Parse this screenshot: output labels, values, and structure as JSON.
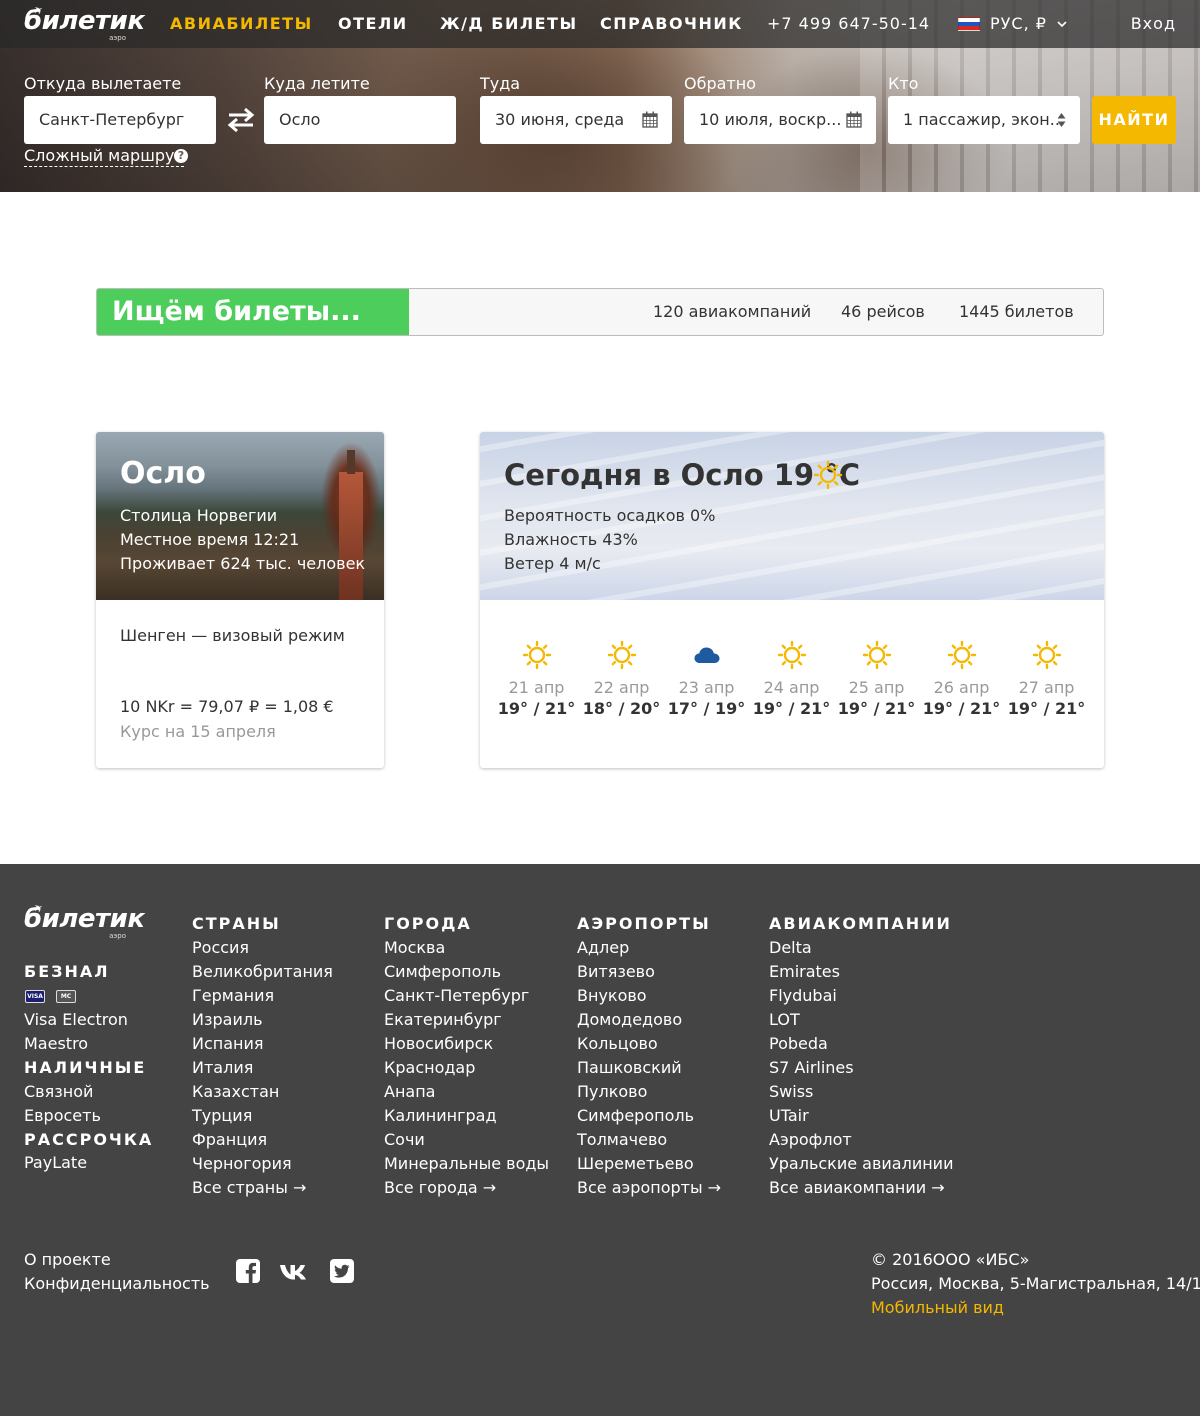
{
  "header": {
    "logo": "билетик",
    "logo_sub": "аэро",
    "nav": [
      "АВИАБИЛЕТЫ",
      "ОТЕЛИ",
      "Ж/Д БИЛЕТЫ",
      "СПРАВОЧНИК"
    ],
    "phone": "+7 499 647-50-14",
    "lang": "РУС, ₽",
    "login": "Вход"
  },
  "search": {
    "from_label": "Откуда вылетаете",
    "from_value": "Санкт-Петербург",
    "to_label": "Куда летите",
    "to_value": "Осло",
    "depart_label": "Туда",
    "depart_value": "30 июня, среда",
    "return_label": "Обратно",
    "return_value": "10 июля, воскр...",
    "who_label": "Кто",
    "who_value": "1 пассажир, экон...",
    "find_button": "НАЙТИ",
    "complex_route": "Сложный маршрут",
    "help_icon": "question-circle-icon"
  },
  "progress": {
    "title": "Ищём билеты...",
    "fraction": 0.31,
    "airlines": "120 авиакомпаний",
    "flights": "46 рейсов",
    "tickets": "1445 билетов"
  },
  "city": {
    "name": "Осло",
    "capital": "Столица Норвегии",
    "local_time": "Местное время 12:21",
    "population": "Проживает 624 тыс. человек",
    "visa": "Шенген — визовый режим",
    "rate": "10 NKr = 79,07 ₽ = 1,08 €",
    "rate_date": "Курс на 15 апреля"
  },
  "weather": {
    "title": "Сегодня в Осло 19 °С",
    "precipitation": "Вероятность осадков 0%",
    "humidity": "Влажность 43%",
    "wind": "Ветер 4 м/с",
    "days": [
      {
        "date": "21 апр",
        "temp": "19° / 21°",
        "icon": "sun-icon"
      },
      {
        "date": "22 апр",
        "temp": "18° / 20°",
        "icon": "sun-icon"
      },
      {
        "date": "23 апр",
        "temp": "17° / 19°",
        "icon": "cloud-icon"
      },
      {
        "date": "24 апр",
        "temp": "19° / 21°",
        "icon": "sun-icon"
      },
      {
        "date": "25 апр",
        "temp": "19° / 21°",
        "icon": "sun-icon"
      },
      {
        "date": "26 апр",
        "temp": "19° / 21°",
        "icon": "sun-icon"
      },
      {
        "date": "27 апр",
        "temp": "19° / 21°",
        "icon": "sun-icon"
      }
    ]
  },
  "footer": {
    "logo": "билетик",
    "logo_sub": "аэро",
    "payment": {
      "cashless_title": "БЕЗНАЛ",
      "cards": [
        "visa-icon",
        "mastercard-icon"
      ],
      "card_labels": [
        "VISA",
        "MC"
      ],
      "cashless_items": [
        "Visa Electron",
        "Maestro"
      ],
      "cash_title": "НАЛИЧНЫЕ",
      "cash_items": [
        "Связной",
        "Евросеть"
      ],
      "installment_title": "РАССРОЧКА",
      "installment_items": [
        "PayLate"
      ]
    },
    "columns": [
      {
        "title": "СТРАНЫ",
        "items": [
          "Россия",
          "Великобритания",
          "Германия",
          "Израиль",
          "Испания",
          "Италия",
          "Казахстан",
          "Турция",
          "Франция",
          "Черногория",
          "Все страны →"
        ]
      },
      {
        "title": "ГОРОДА",
        "items": [
          "Москва",
          "Симферополь",
          "Санкт-Петербург",
          "Екатеринбург",
          "Новосибирск",
          "Краснодар",
          "Анапа",
          "Калининград",
          "Сочи",
          "Минеральные воды",
          "Все города →"
        ]
      },
      {
        "title": "АЭРОПОРТЫ",
        "items": [
          "Адлер",
          "Витязево",
          "Внуково",
          "Домодедово",
          "Кольцово",
          "Пашковский",
          "Пулково",
          "Симферополь",
          "Толмачево",
          "Шереметьево",
          "Все аэропорты →"
        ]
      },
      {
        "title": "АВИАКОМПАНИИ",
        "items": [
          "Delta",
          "Emirates",
          "Flydubai",
          "LOT",
          "Pobeda",
          "S7 Airlines",
          "Swiss",
          "UTair",
          "Аэрофлот",
          "Уральские авиалинии",
          "Все авиакомпании →"
        ]
      }
    ],
    "about": "О проекте",
    "privacy": "Конфиденциальность",
    "social": [
      "facebook-icon",
      "vk-icon",
      "twitter-icon"
    ],
    "copyright": "© 2016ООО «ИБС»",
    "address": "Россия, Москва, 5-Магистральная, 14/1",
    "mobile": "Мобильный вид"
  },
  "colors": {
    "accent": "#f5b800",
    "progress_green": "#4ccd5c",
    "footer_bg": "#444444",
    "sun": "#f5b800",
    "cloud": "#1e5aa0"
  }
}
